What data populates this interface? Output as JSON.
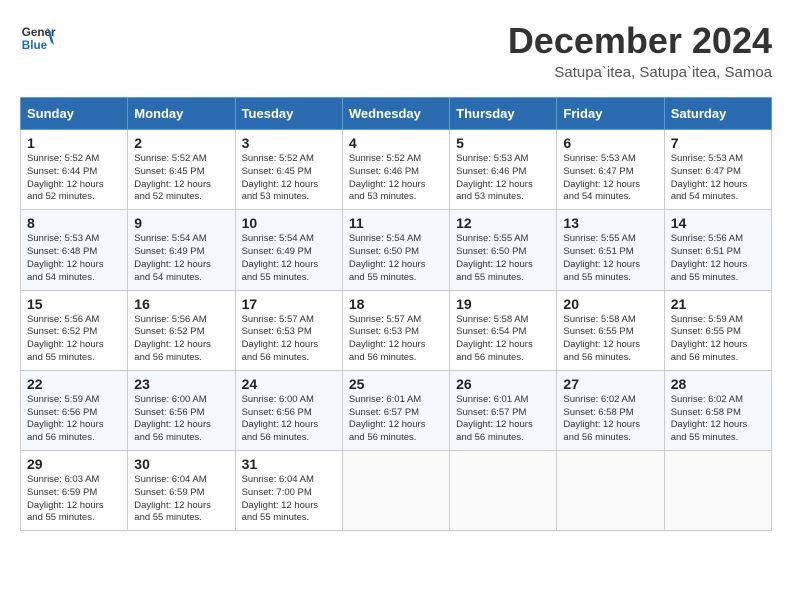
{
  "logo": {
    "line1": "General",
    "line2": "Blue"
  },
  "title": "December 2024",
  "subtitle": "Satupa`itea, Satupa`itea, Samoa",
  "days_of_week": [
    "Sunday",
    "Monday",
    "Tuesday",
    "Wednesday",
    "Thursday",
    "Friday",
    "Saturday"
  ],
  "weeks": [
    [
      {
        "day": "1",
        "sunrise": "5:52 AM",
        "sunset": "6:44 PM",
        "daylight": "12 hours and 52 minutes."
      },
      {
        "day": "2",
        "sunrise": "5:52 AM",
        "sunset": "6:45 PM",
        "daylight": "12 hours and 52 minutes."
      },
      {
        "day": "3",
        "sunrise": "5:52 AM",
        "sunset": "6:45 PM",
        "daylight": "12 hours and 53 minutes."
      },
      {
        "day": "4",
        "sunrise": "5:52 AM",
        "sunset": "6:46 PM",
        "daylight": "12 hours and 53 minutes."
      },
      {
        "day": "5",
        "sunrise": "5:53 AM",
        "sunset": "6:46 PM",
        "daylight": "12 hours and 53 minutes."
      },
      {
        "day": "6",
        "sunrise": "5:53 AM",
        "sunset": "6:47 PM",
        "daylight": "12 hours and 54 minutes."
      },
      {
        "day": "7",
        "sunrise": "5:53 AM",
        "sunset": "6:47 PM",
        "daylight": "12 hours and 54 minutes."
      }
    ],
    [
      {
        "day": "8",
        "sunrise": "5:53 AM",
        "sunset": "6:48 PM",
        "daylight": "12 hours and 54 minutes."
      },
      {
        "day": "9",
        "sunrise": "5:54 AM",
        "sunset": "6:49 PM",
        "daylight": "12 hours and 54 minutes."
      },
      {
        "day": "10",
        "sunrise": "5:54 AM",
        "sunset": "6:49 PM",
        "daylight": "12 hours and 55 minutes."
      },
      {
        "day": "11",
        "sunrise": "5:54 AM",
        "sunset": "6:50 PM",
        "daylight": "12 hours and 55 minutes."
      },
      {
        "day": "12",
        "sunrise": "5:55 AM",
        "sunset": "6:50 PM",
        "daylight": "12 hours and 55 minutes."
      },
      {
        "day": "13",
        "sunrise": "5:55 AM",
        "sunset": "6:51 PM",
        "daylight": "12 hours and 55 minutes."
      },
      {
        "day": "14",
        "sunrise": "5:56 AM",
        "sunset": "6:51 PM",
        "daylight": "12 hours and 55 minutes."
      }
    ],
    [
      {
        "day": "15",
        "sunrise": "5:56 AM",
        "sunset": "6:52 PM",
        "daylight": "12 hours and 55 minutes."
      },
      {
        "day": "16",
        "sunrise": "5:56 AM",
        "sunset": "6:52 PM",
        "daylight": "12 hours and 56 minutes."
      },
      {
        "day": "17",
        "sunrise": "5:57 AM",
        "sunset": "6:53 PM",
        "daylight": "12 hours and 56 minutes."
      },
      {
        "day": "18",
        "sunrise": "5:57 AM",
        "sunset": "6:53 PM",
        "daylight": "12 hours and 56 minutes."
      },
      {
        "day": "19",
        "sunrise": "5:58 AM",
        "sunset": "6:54 PM",
        "daylight": "12 hours and 56 minutes."
      },
      {
        "day": "20",
        "sunrise": "5:58 AM",
        "sunset": "6:55 PM",
        "daylight": "12 hours and 56 minutes."
      },
      {
        "day": "21",
        "sunrise": "5:59 AM",
        "sunset": "6:55 PM",
        "daylight": "12 hours and 56 minutes."
      }
    ],
    [
      {
        "day": "22",
        "sunrise": "5:59 AM",
        "sunset": "6:56 PM",
        "daylight": "12 hours and 56 minutes."
      },
      {
        "day": "23",
        "sunrise": "6:00 AM",
        "sunset": "6:56 PM",
        "daylight": "12 hours and 56 minutes."
      },
      {
        "day": "24",
        "sunrise": "6:00 AM",
        "sunset": "6:56 PM",
        "daylight": "12 hours and 56 minutes."
      },
      {
        "day": "25",
        "sunrise": "6:01 AM",
        "sunset": "6:57 PM",
        "daylight": "12 hours and 56 minutes."
      },
      {
        "day": "26",
        "sunrise": "6:01 AM",
        "sunset": "6:57 PM",
        "daylight": "12 hours and 56 minutes."
      },
      {
        "day": "27",
        "sunrise": "6:02 AM",
        "sunset": "6:58 PM",
        "daylight": "12 hours and 56 minutes."
      },
      {
        "day": "28",
        "sunrise": "6:02 AM",
        "sunset": "6:58 PM",
        "daylight": "12 hours and 55 minutes."
      }
    ],
    [
      {
        "day": "29",
        "sunrise": "6:03 AM",
        "sunset": "6:59 PM",
        "daylight": "12 hours and 55 minutes."
      },
      {
        "day": "30",
        "sunrise": "6:04 AM",
        "sunset": "6:59 PM",
        "daylight": "12 hours and 55 minutes."
      },
      {
        "day": "31",
        "sunrise": "6:04 AM",
        "sunset": "7:00 PM",
        "daylight": "12 hours and 55 minutes."
      },
      null,
      null,
      null,
      null
    ]
  ]
}
